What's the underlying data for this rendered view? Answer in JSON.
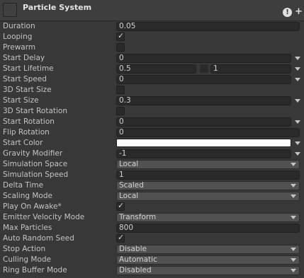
{
  "header": {
    "title": "Particle System"
  },
  "rows": [
    {
      "label": "Duration",
      "type": "text",
      "value": "0.05"
    },
    {
      "label": "Looping",
      "type": "checkbox",
      "checked": true
    },
    {
      "label": "Prewarm",
      "type": "checkbox",
      "checked": false
    },
    {
      "label": "Start Delay",
      "type": "text-arrow",
      "value": "0"
    },
    {
      "label": "Start Lifetime",
      "type": "range",
      "value": "0.5",
      "value2": "1"
    },
    {
      "label": "Start Speed",
      "type": "text-arrow",
      "value": "0"
    },
    {
      "label": "3D Start Size",
      "type": "checkbox",
      "checked": false
    },
    {
      "label": "Start Size",
      "type": "text-arrow",
      "value": "0.3"
    },
    {
      "label": "3D Start Rotation",
      "type": "checkbox",
      "checked": false
    },
    {
      "label": "Start Rotation",
      "type": "text-arrow",
      "value": "0"
    },
    {
      "label": "Flip Rotation",
      "type": "text",
      "value": "0"
    },
    {
      "label": "Start Color",
      "type": "color",
      "color": "#ffffff"
    },
    {
      "label": "Gravity Modifier",
      "type": "text-arrow",
      "value": "-1"
    },
    {
      "label": "Simulation Space",
      "type": "dropdown",
      "value": "Local"
    },
    {
      "label": "Simulation Speed",
      "type": "text",
      "value": "1"
    },
    {
      "label": "Delta Time",
      "type": "dropdown",
      "value": "Scaled"
    },
    {
      "label": "Scaling Mode",
      "type": "dropdown",
      "value": "Local"
    },
    {
      "label": "Play On Awake*",
      "type": "checkbox",
      "checked": true
    },
    {
      "label": "Emitter Velocity Mode",
      "type": "dropdown",
      "value": "Transform"
    },
    {
      "label": "Max Particles",
      "type": "text",
      "value": "800"
    },
    {
      "label": "Auto Random Seed",
      "type": "checkbox",
      "checked": true
    },
    {
      "label": "Stop Action",
      "type": "dropdown",
      "value": "Disable"
    },
    {
      "label": "Culling Mode",
      "type": "dropdown",
      "value": "Automatic"
    },
    {
      "label": "Ring Buffer Mode",
      "type": "dropdown",
      "value": "Disabled"
    }
  ],
  "check_glyph": "✓",
  "icons": {
    "help": "help-icon",
    "add": "plus-icon",
    "arrow": "chevron-down-icon"
  }
}
